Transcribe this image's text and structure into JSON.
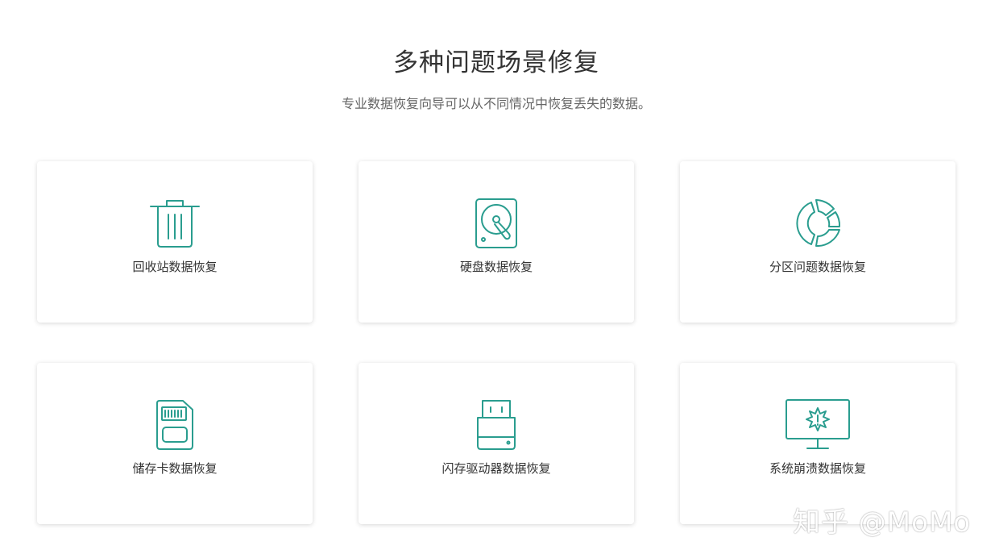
{
  "header": {
    "title": "多种问题场景修复",
    "subtitle": "专业数据恢复向导可以从不同情况中恢复丢失的数据。"
  },
  "colors": {
    "accent": "#2a9d8f",
    "text": "#333333",
    "subtext": "#666666"
  },
  "cards": [
    {
      "label": "回收站数据恢复",
      "icon": "trash-icon"
    },
    {
      "label": "硬盘数据恢复",
      "icon": "hard-disk-icon"
    },
    {
      "label": "分区问题数据恢复",
      "icon": "partition-icon"
    },
    {
      "label": "储存卡数据恢复",
      "icon": "sd-card-icon"
    },
    {
      "label": "闪存驱动器数据恢复",
      "icon": "usb-drive-icon"
    },
    {
      "label": "系统崩溃数据恢复",
      "icon": "monitor-crash-icon"
    }
  ],
  "watermark": "知乎 @MoMo"
}
